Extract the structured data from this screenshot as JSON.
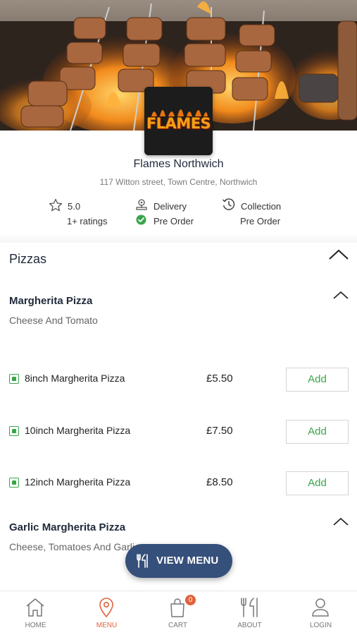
{
  "restaurant": {
    "logo_text": "FLAMES",
    "name": "Flames Northwich",
    "address": "117 Witton street, Town Centre, Northwich",
    "rating": "5.0",
    "ratings_count": "1+ ratings",
    "delivery_label": "Delivery",
    "delivery_mode": "Pre Order",
    "collection_label": "Collection",
    "collection_mode": "Pre Order"
  },
  "menu": {
    "section_title": "Pizzas",
    "items": [
      {
        "title": "Margherita Pizza",
        "description": "Cheese And Tomato",
        "variants": [
          {
            "name": "8inch Margherita Pizza",
            "price": "£5.50",
            "button": "Add"
          },
          {
            "name": "10inch Margherita Pizza",
            "price": "£7.50",
            "button": "Add"
          },
          {
            "name": "12inch Margherita Pizza",
            "price": "£8.50",
            "button": "Add"
          }
        ]
      },
      {
        "title": "Garlic Margherita Pizza",
        "description": "Cheese, Tomatoes And Garlic"
      }
    ]
  },
  "view_menu_button": "VIEW MENU",
  "bottom_nav": [
    {
      "label": "HOME",
      "icon": "home-icon"
    },
    {
      "label": "MENU",
      "icon": "location-pin-icon",
      "active": true
    },
    {
      "label": "CART",
      "icon": "bag-icon",
      "badge": "0"
    },
    {
      "label": "ABOUT",
      "icon": "cutlery-icon"
    },
    {
      "label": "LOGIN",
      "icon": "user-icon"
    }
  ],
  "colors": {
    "accent_green": "#3aa54a",
    "accent_orange": "#e0623a",
    "view_menu_bg": "#35507a",
    "title_navy": "#1f2a3a"
  }
}
